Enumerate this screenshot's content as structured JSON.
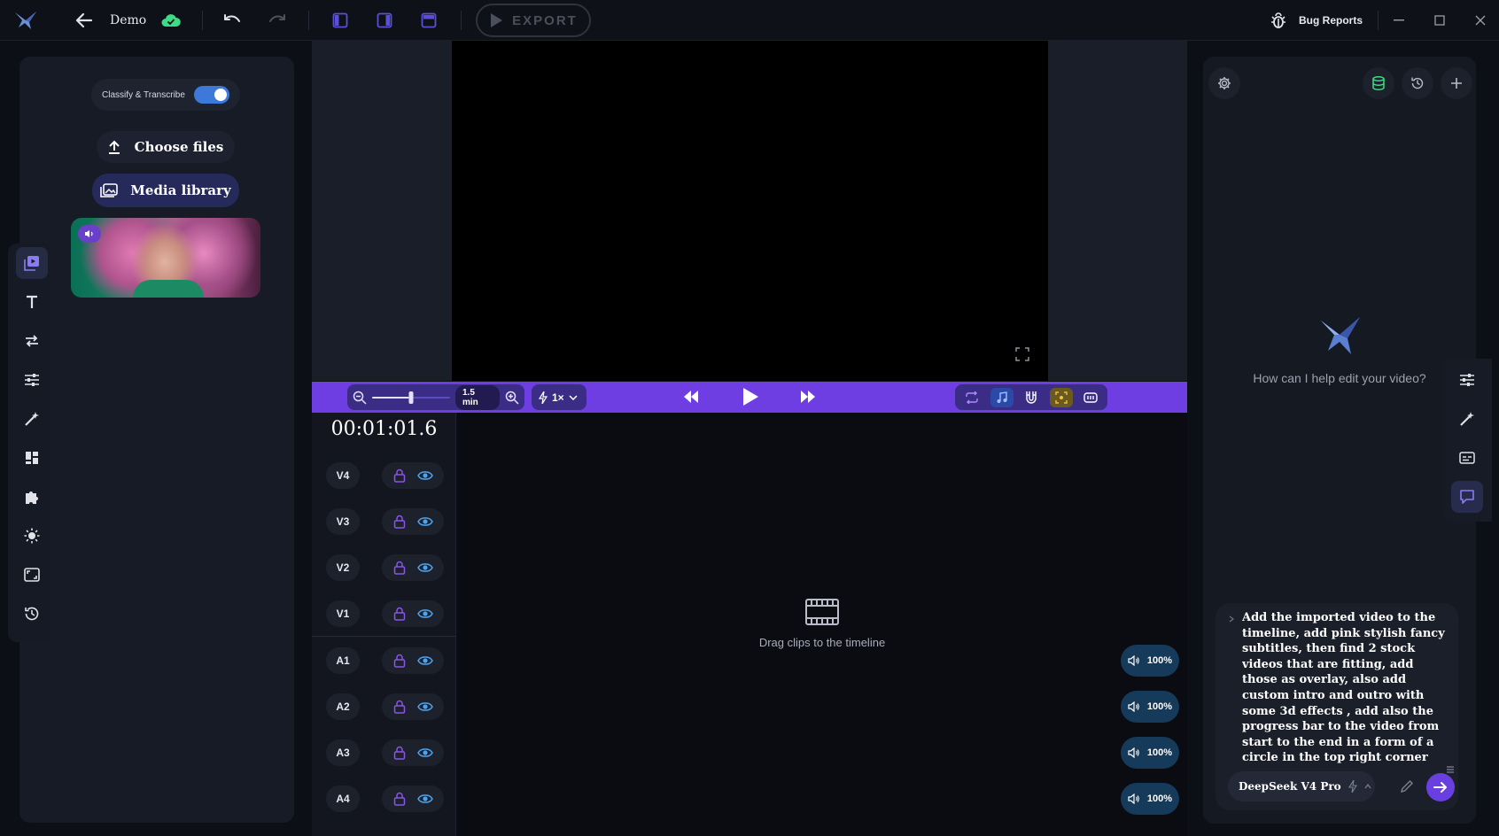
{
  "titlebar": {
    "project_name": "Demo",
    "export_label": "EXPORT",
    "bug_reports_label": "Bug Reports"
  },
  "left_panel": {
    "classify_label": "Classify & Transcribe",
    "classify_enabled": true,
    "choose_files_label": "Choose files",
    "media_library_label": "Media library"
  },
  "rail": {
    "items": [
      "media-icon",
      "text-icon",
      "transitions-icon",
      "adjust-icon",
      "effects-wand-icon",
      "templates-grid-icon",
      "plugins-puzzle-icon",
      "brightness-icon",
      "aspect-ratio-icon",
      "history-icon"
    ],
    "active_index": 0
  },
  "transport": {
    "zoom_readout": "1.5 min",
    "zoom_level": 0.5,
    "speed_label": "1×"
  },
  "timeline": {
    "timecode": "00:01:01.6",
    "tracks": [
      {
        "label": "V4"
      },
      {
        "label": "V3"
      },
      {
        "label": "V2"
      },
      {
        "label": "V1"
      },
      {
        "label": "A1",
        "volume": "100%"
      },
      {
        "label": "A2",
        "volume": "100%"
      },
      {
        "label": "A3",
        "volume": "100%"
      },
      {
        "label": "A4",
        "volume": "100%"
      }
    ],
    "empty_hint": "Drag clips to the timeline"
  },
  "ai_panel": {
    "prompt": "How can I help edit your video?",
    "chat_input": "Add the imported video to the timeline, add pink stylish fancy subtitles, then find 2 stock videos that are fitting, add those as overlay, also add custom intro and outro with some 3d effects , add also the progress bar to the video from start to the end in a form of a circle in the top right corner that is being filled with rainbow colors as the vide progresses, each intro outro and progress bar is separate custom clip",
    "model_name": "DeepSeek V4 Pro"
  },
  "colors": {
    "accent": "#6f3ee2",
    "toggle_on": "#3c79d8",
    "cloud_ok": "#3ddc84",
    "eye_icon": "#4aa3f0",
    "lock_icon": "#8a55e8"
  }
}
